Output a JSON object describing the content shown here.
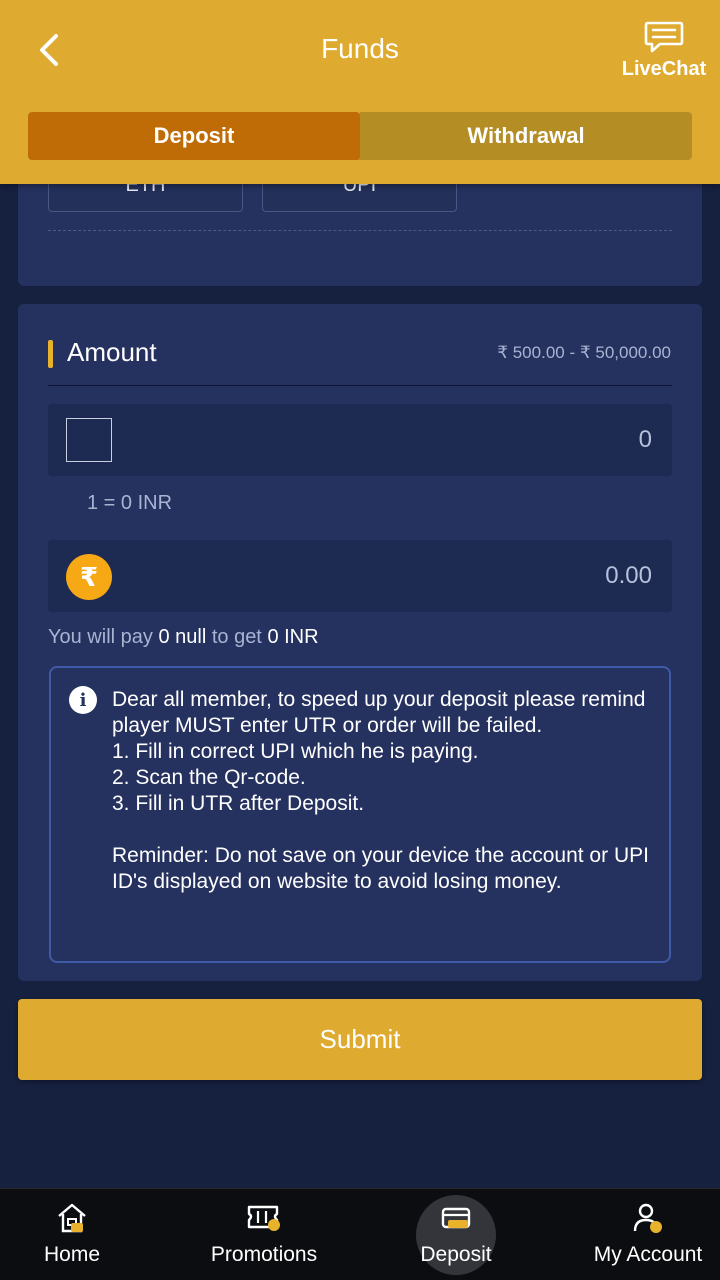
{
  "header": {
    "title": "Funds",
    "livechat_label": "LiveChat"
  },
  "tabs": {
    "deposit": "Deposit",
    "withdrawal": "Withdrawal"
  },
  "methods": [
    {
      "label": "ETH"
    },
    {
      "label": "UPI"
    }
  ],
  "amount": {
    "title": "Amount",
    "range": "₹ 500.00 - ₹ 50,000.00",
    "crypto_value": "0",
    "rate": "1 = 0 INR",
    "rupee_symbol": "₹",
    "inr_value": "0.00",
    "pay_prefix": "You will pay",
    "pay_amount": "0 null",
    "pay_middle": "to get",
    "pay_get": "0 INR"
  },
  "notice": {
    "icon": "i",
    "lines": [
      "Dear all member, to speed up your deposit please remind player MUST enter UTR or order will be failed.",
      "1. Fill in correct UPI which he is paying.",
      "2. Scan the Qr-code.",
      "3. Fill in UTR after Deposit.",
      "Reminder: Do not save on your device the account or UPI ID's displayed on website to avoid losing money."
    ]
  },
  "submit_label": "Submit",
  "nav": {
    "home": "Home",
    "promotions": "Promotions",
    "deposit": "Deposit",
    "account": "My Account"
  },
  "colors": {
    "header": "#dfaa30",
    "tab_active": "#bf6c06",
    "background": "#16203f",
    "card": "#25315e",
    "rupee_icon": "#f6a815"
  }
}
